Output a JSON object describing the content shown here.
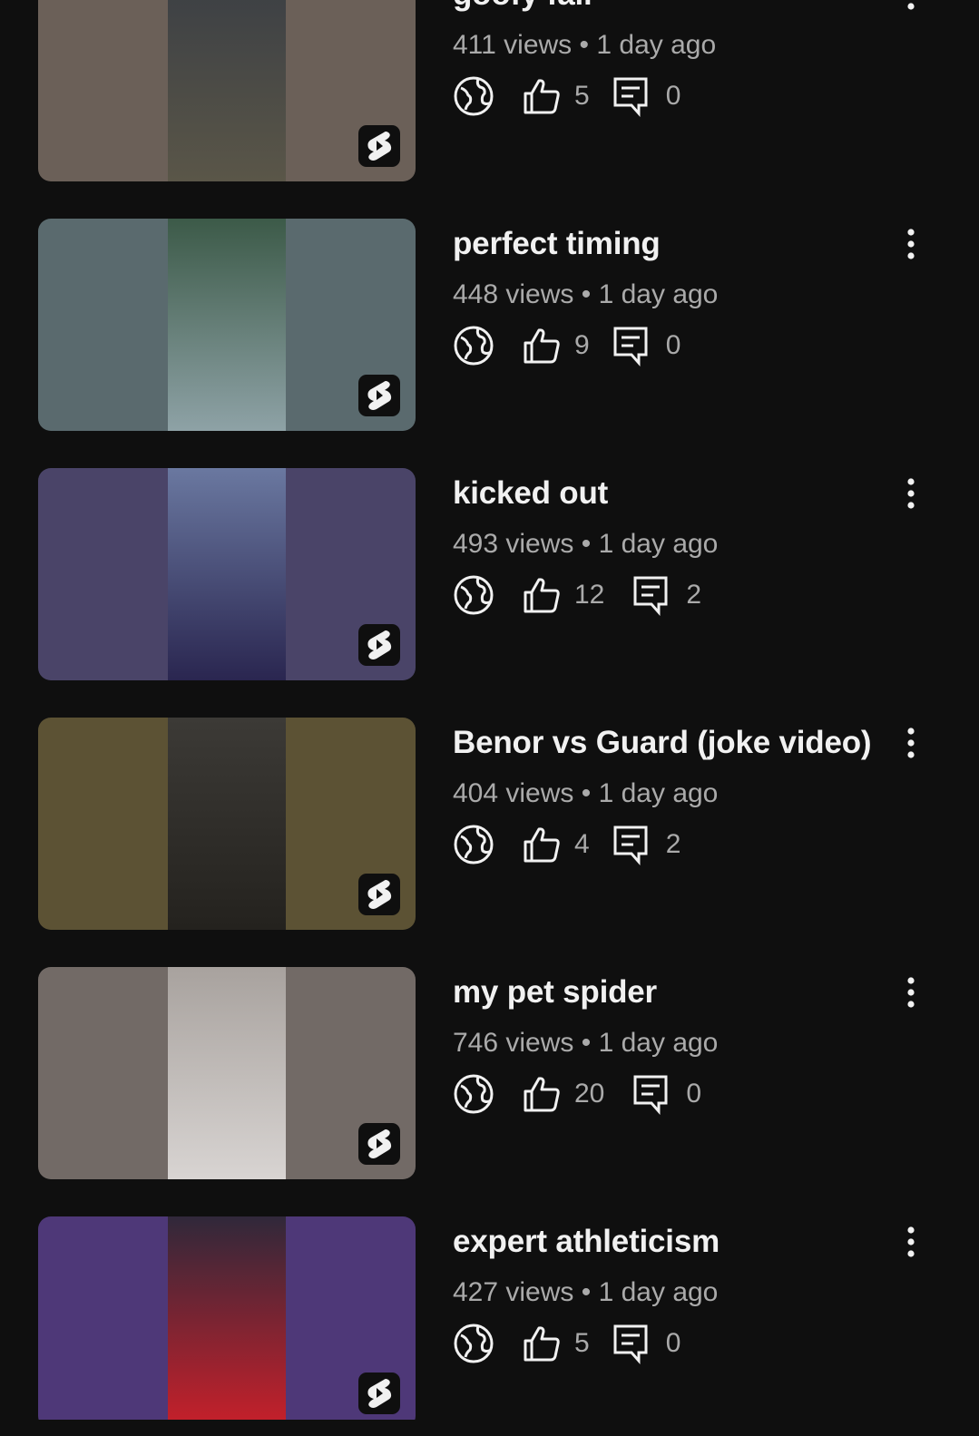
{
  "videos": [
    {
      "title": "goofy fail",
      "views": "411 views",
      "age": "1 day ago",
      "likes": "5",
      "comments": "0",
      "thumb_bg": "#6b6058",
      "frame_top": "#3a3e44",
      "frame_bottom": "#5a5648",
      "visibility_icon": "globe-icon"
    },
    {
      "title": "perfect timing",
      "views": "448 views",
      "age": "1 day ago",
      "likes": "9",
      "comments": "0",
      "thumb_bg": "#5a6a6e",
      "frame_top": "#3c5a48",
      "frame_bottom": "#8ea2a6",
      "visibility_icon": "globe-icon"
    },
    {
      "title": "kicked out",
      "views": "493 views",
      "age": "1 day ago",
      "likes": "12",
      "comments": "2",
      "thumb_bg": "#4a4468",
      "frame_top": "#6a78a0",
      "frame_bottom": "#2a2650",
      "visibility_icon": "globe-icon"
    },
    {
      "title": "Benor vs Guard (joke video)",
      "views": "404 views",
      "age": "1 day ago",
      "likes": "4",
      "comments": "2",
      "thumb_bg": "#5c5234",
      "frame_top": "#3c3a36",
      "frame_bottom": "#24221e",
      "visibility_icon": "globe-icon"
    },
    {
      "title": "my pet spider",
      "views": "746 views",
      "age": "1 day ago",
      "likes": "20",
      "comments": "0",
      "thumb_bg": "#726a66",
      "frame_top": "#a8a29e",
      "frame_bottom": "#d8d4d2",
      "visibility_icon": "globe-icon"
    },
    {
      "title": "expert athleticism",
      "views": "427 views",
      "age": "1 day ago",
      "likes": "5",
      "comments": "0",
      "thumb_bg": "#4e3878",
      "frame_top": "#30283a",
      "frame_bottom": "#c8202a",
      "visibility_icon": "globe-icon"
    }
  ],
  "icons": {
    "shorts": "shorts-logo-icon",
    "visibility": "globe-icon",
    "likes": "thumbs-up-icon",
    "comments": "comment-icon",
    "menu": "more-vert-icon"
  },
  "colors": {
    "background": "#0f0f0f",
    "title_text": "#f1f1f1",
    "secondary_text": "#aaaaaa"
  }
}
